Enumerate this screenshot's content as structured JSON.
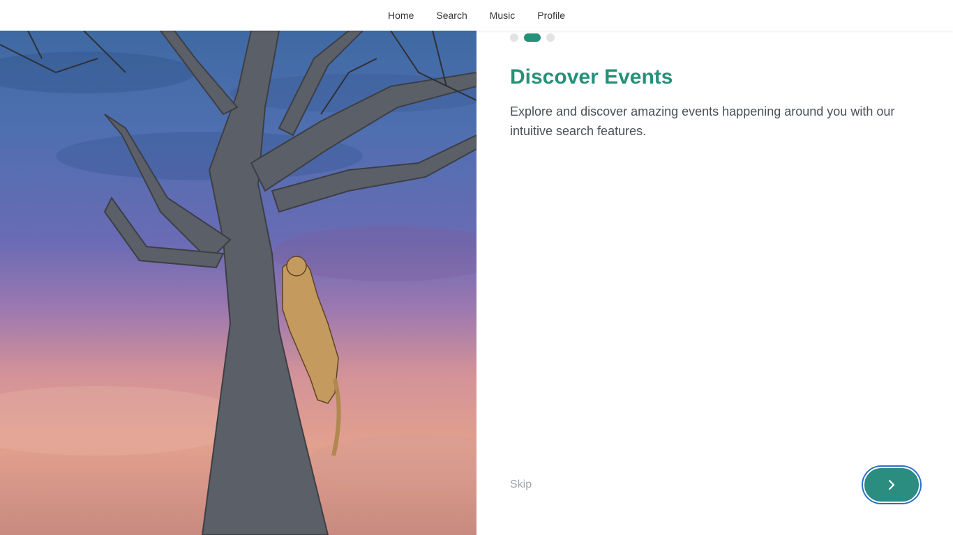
{
  "nav": {
    "items": [
      {
        "label": "Home"
      },
      {
        "label": "Search"
      },
      {
        "label": "Music"
      },
      {
        "label": "Profile"
      }
    ]
  },
  "hero": {
    "image_icon": "leopard-tree-photo"
  },
  "onboarding": {
    "pager": {
      "total": 3,
      "active_index": 1
    },
    "title": "Discover Events",
    "description": "Explore and discover amazing events happening around you with our intuitive search features.",
    "skip_label": "Skip",
    "next_icon": "chevron-right-icon"
  },
  "colors": {
    "accent": "#249178",
    "button": "#2b8c80",
    "focus_ring": "#2a6fc9",
    "dot_inactive": "#e3e3e3",
    "text_body": "#4a4f57",
    "text_muted": "#a0a4a8"
  }
}
